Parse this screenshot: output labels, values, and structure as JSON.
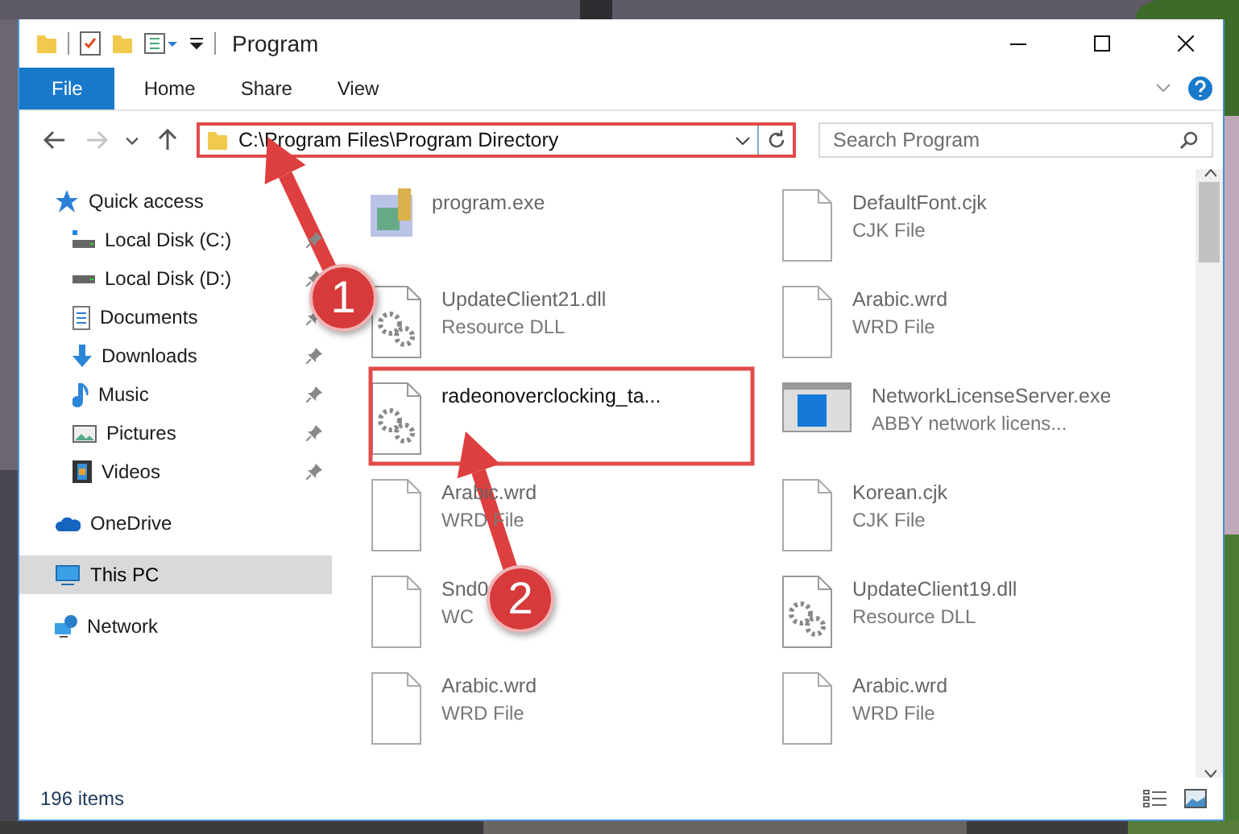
{
  "window": {
    "title": "Program"
  },
  "ribbon_tabs": [
    {
      "label": "File",
      "kind": "file"
    },
    {
      "label": "Home",
      "kind": "tab"
    },
    {
      "label": "Share",
      "kind": "tab"
    },
    {
      "label": "View",
      "kind": "tab"
    }
  ],
  "nav": {
    "forward_disabled": true
  },
  "address": {
    "value": "C:\\Program Files\\Program Directory"
  },
  "search": {
    "placeholder": "Search Program"
  },
  "sidebar": [
    {
      "label": "Quick access",
      "selected": false,
      "children": [
        {
          "label": "Local Disk (C:)",
          "pinned": true,
          "selected": false
        },
        {
          "label": "Local Disk (D:)",
          "pinned": true,
          "selected": false
        },
        {
          "label": "Documents",
          "pinned": true,
          "selected": false
        },
        {
          "label": "Downloads",
          "pinned": true,
          "selected": false
        },
        {
          "label": "Music",
          "pinned": true,
          "selected": false
        },
        {
          "label": "Pictures",
          "pinned": true,
          "selected": false
        },
        {
          "label": "Videos",
          "pinned": true,
          "selected": false
        }
      ]
    },
    {
      "label": "OneDrive",
      "selected": false
    },
    {
      "label": "This PC",
      "selected": true
    },
    {
      "label": "Network",
      "selected": false
    }
  ],
  "files": [
    {
      "name": "program.exe",
      "kind": "app",
      "dimmed": true
    },
    {
      "name": "DefaultFont.cjk",
      "type": "CJK File",
      "kind": "blank",
      "dimmed": true
    },
    {
      "name": "UpdateClient21.dll",
      "type": "Resource DLL",
      "kind": "gears",
      "dimmed": true
    },
    {
      "name": "Arabic.wrd",
      "type": "WRD File",
      "kind": "blank",
      "dimmed": true
    },
    {
      "name": "radeonoverclocking_ta...",
      "kind": "gears",
      "dimmed": false
    },
    {
      "name": "NetworkLicenseServer.exe",
      "type": "ABBY network licens...",
      "kind": "window",
      "dimmed": true
    },
    {
      "name": "Arabic.wrd",
      "type": "WRD File",
      "kind": "blank",
      "dimmed": true
    },
    {
      "name": "Korean.cjk",
      "type": "CJK File",
      "kind": "blank",
      "dimmed": true
    },
    {
      "name": "Snd0",
      "type": "WC",
      "kind": "blank",
      "dimmed": true
    },
    {
      "name": "UpdateClient19.dll",
      "type": "Resource DLL",
      "kind": "gears",
      "dimmed": true
    },
    {
      "name": "Arabic.wrd",
      "type": "WRD File",
      "kind": "blank",
      "dimmed": true
    },
    {
      "name": "Arabic.wrd",
      "type": "WRD File",
      "kind": "blank",
      "dimmed": true
    }
  ],
  "status_bar": {
    "count": "196 items"
  },
  "annotations": [
    {
      "label": "1"
    },
    {
      "label": "2"
    }
  ]
}
